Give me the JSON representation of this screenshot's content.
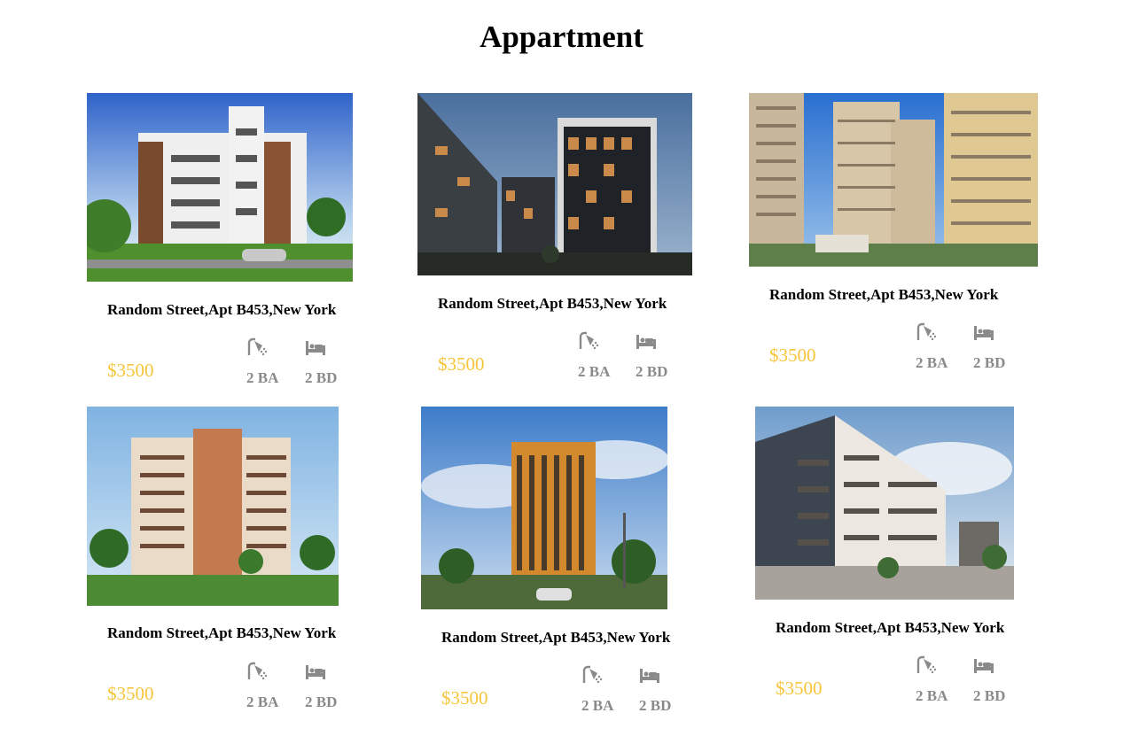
{
  "page": {
    "title": "Appartment"
  },
  "listings": [
    {
      "address": "Random Street,Apt B453,New York",
      "price": "$3500",
      "baths": "2 BA",
      "beds": "2 BD",
      "photo": "modern-brown-white-apartment-photo"
    },
    {
      "address": "Random Street,Apt B453,New York",
      "price": "$3500",
      "baths": "2 BA",
      "beds": "2 BD",
      "photo": "dark-facade-apartment-at-dusk-photo"
    },
    {
      "address": "Random Street,Apt B453,New York",
      "price": "$3500",
      "baths": "2 BA",
      "beds": "2 BD",
      "photo": "beige-highrise-towers-photo"
    },
    {
      "address": "Random Street,Apt B453,New York",
      "price": "$3500",
      "baths": "2 BA",
      "beds": "2 BD",
      "photo": "tall-apartment-with-palms-photo"
    },
    {
      "address": "Random Street,Apt B453,New York",
      "price": "$3500",
      "baths": "2 BA",
      "beds": "2 BD",
      "photo": "orange-striped-tower-photo"
    },
    {
      "address": "Random Street,Apt B453,New York",
      "price": "$3500",
      "baths": "2 BA",
      "beds": "2 BD",
      "photo": "white-balcony-apartment-courtyard-photo"
    }
  ],
  "icons": {
    "bath": "shower-icon",
    "bed": "bed-icon"
  },
  "colors": {
    "price": "#f5c53a",
    "feature_text": "#8a8a8a"
  }
}
